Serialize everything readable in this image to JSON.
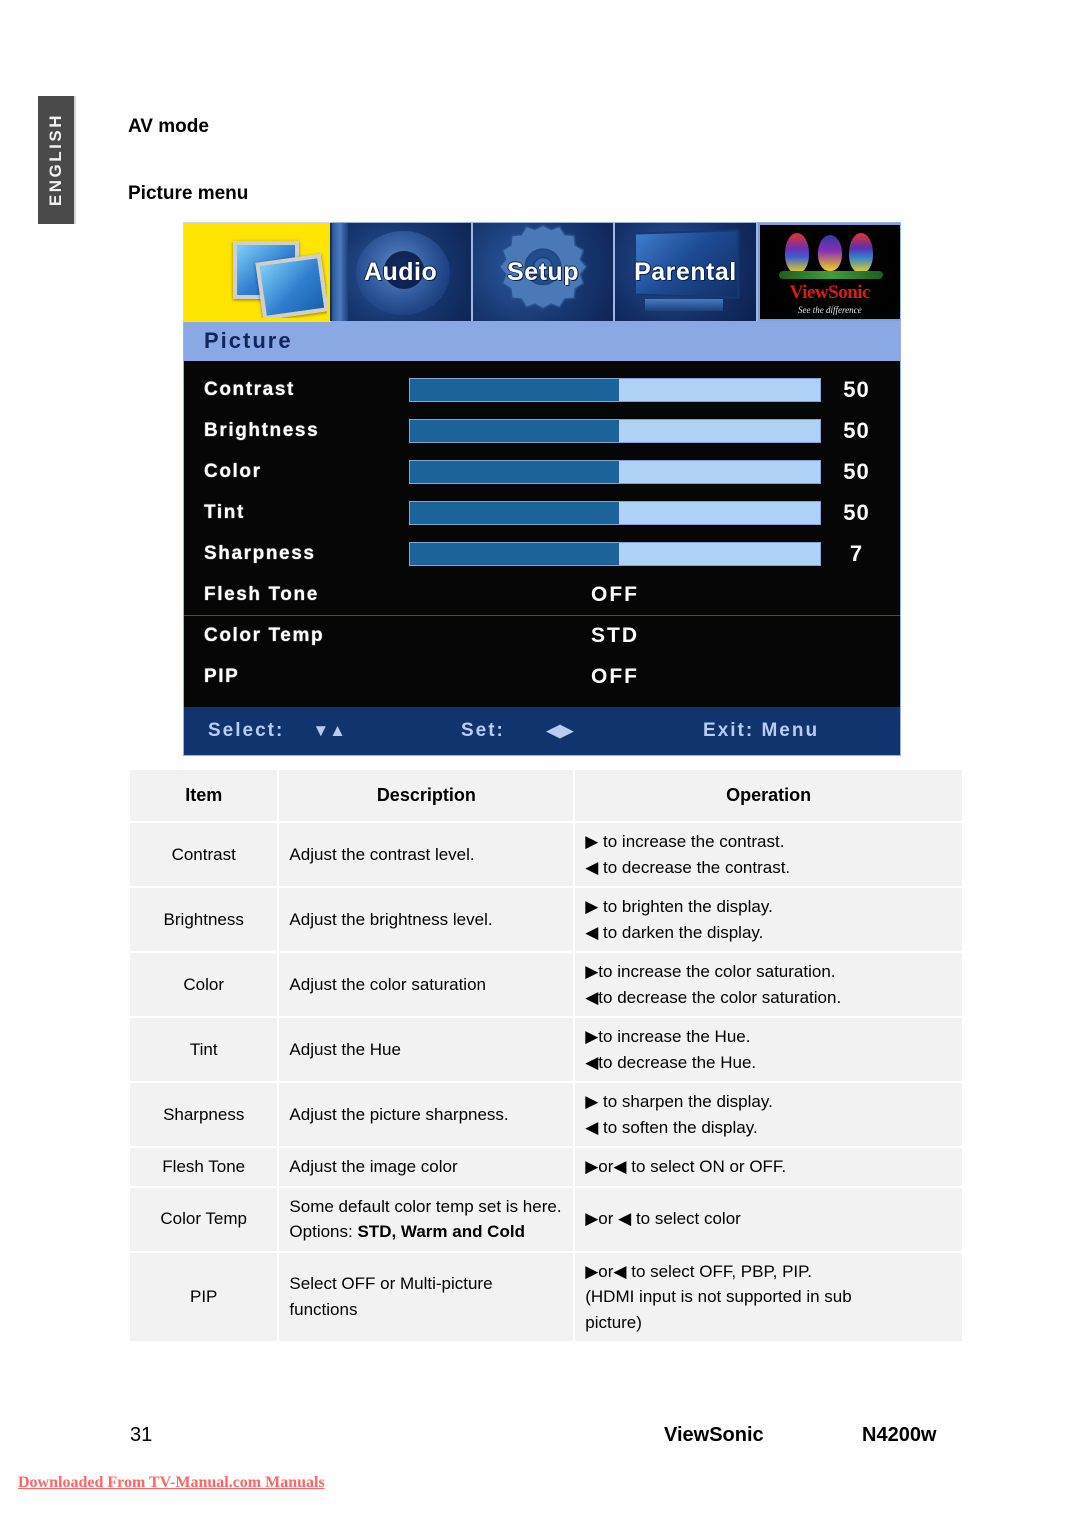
{
  "sidebar": {
    "language_tab": "ENGLISH"
  },
  "headings": {
    "av_mode": "AV mode",
    "picture_menu": "Picture menu"
  },
  "osd": {
    "tabs": [
      {
        "label": "",
        "name": "picture",
        "selected": true
      },
      {
        "label": "Audio",
        "name": "audio",
        "selected": false
      },
      {
        "label": "Setup",
        "name": "setup",
        "selected": false
      },
      {
        "label": "Parental",
        "name": "parental",
        "selected": false
      }
    ],
    "logo": {
      "word": "ViewSonic",
      "tagline": "See the difference"
    },
    "title": "Picture",
    "rows": [
      {
        "label": "Contrast",
        "type": "slider",
        "value": "50",
        "fill_pct": 51
      },
      {
        "label": "Brightness",
        "type": "slider",
        "value": "50",
        "fill_pct": 51
      },
      {
        "label": "Color",
        "type": "slider",
        "value": "50",
        "fill_pct": 51
      },
      {
        "label": "Tint",
        "type": "slider",
        "value": "50",
        "fill_pct": 51
      },
      {
        "label": "Sharpness",
        "type": "slider",
        "value": "7",
        "fill_pct": 51
      },
      {
        "label": "Flesh Tone",
        "type": "option",
        "value": "OFF"
      },
      {
        "label": "Color Temp",
        "type": "option",
        "value": "STD"
      },
      {
        "label": "PIP",
        "type": "option",
        "value": "OFF"
      }
    ],
    "footer": {
      "select_label": "Select:",
      "select_arrows": "▼▲",
      "set_label": "Set:",
      "set_arrows": "◀▶",
      "exit_label": "Exit: Menu"
    },
    "colors": {
      "slider_fill": "#1c6399",
      "slider_track": "#aed1f5",
      "title_band": "#8aa8e4",
      "body_bg": "#060606",
      "footer_bg": "#12346e",
      "selected_tab": "#ffe400"
    }
  },
  "table": {
    "headers": {
      "item": "Item",
      "description": "Description",
      "operation": "Operation"
    },
    "rows": [
      {
        "item": "Contrast",
        "description": "Adjust the contrast level.",
        "operation": [
          "▶ to increase the contrast.",
          "◀ to decrease the contrast."
        ]
      },
      {
        "item": "Brightness",
        "description": "Adjust the brightness level.",
        "operation": [
          "▶ to brighten the display.",
          "◀ to darken the display."
        ]
      },
      {
        "item": "Color",
        "description": "Adjust the color saturation",
        "operation": [
          "▶to increase the color saturation.",
          "◀to decrease the color saturation."
        ]
      },
      {
        "item": "Tint",
        "description": "Adjust the Hue",
        "operation": [
          "▶to increase the Hue.",
          "◀to decrease the Hue."
        ]
      },
      {
        "item": "Sharpness",
        "description": "Adjust the picture sharpness.",
        "operation": [
          "▶ to sharpen the display.",
          "◀ to soften the display."
        ]
      },
      {
        "item": "Flesh Tone",
        "description": "Adjust the image color",
        "operation": [
          "▶or◀ to select ON or OFF."
        ]
      },
      {
        "item": "Color Temp",
        "description_pre": "Some default color temp set is here. Options: ",
        "description_bold": "STD, Warm and Cold",
        "operation": [
          "▶or ◀ to select color"
        ]
      },
      {
        "item": "PIP",
        "description": "Select OFF or Multi-picture functions",
        "operation": [
          "▶or◀ to select OFF, PBP, PIP.",
          "(HDMI input is not supported in sub",
          "picture)"
        ]
      }
    ]
  },
  "footer": {
    "page_number": "31",
    "brand": "ViewSonic",
    "model": "N4200w",
    "watermark": "Downloaded From TV-Manual.com Manuals"
  }
}
